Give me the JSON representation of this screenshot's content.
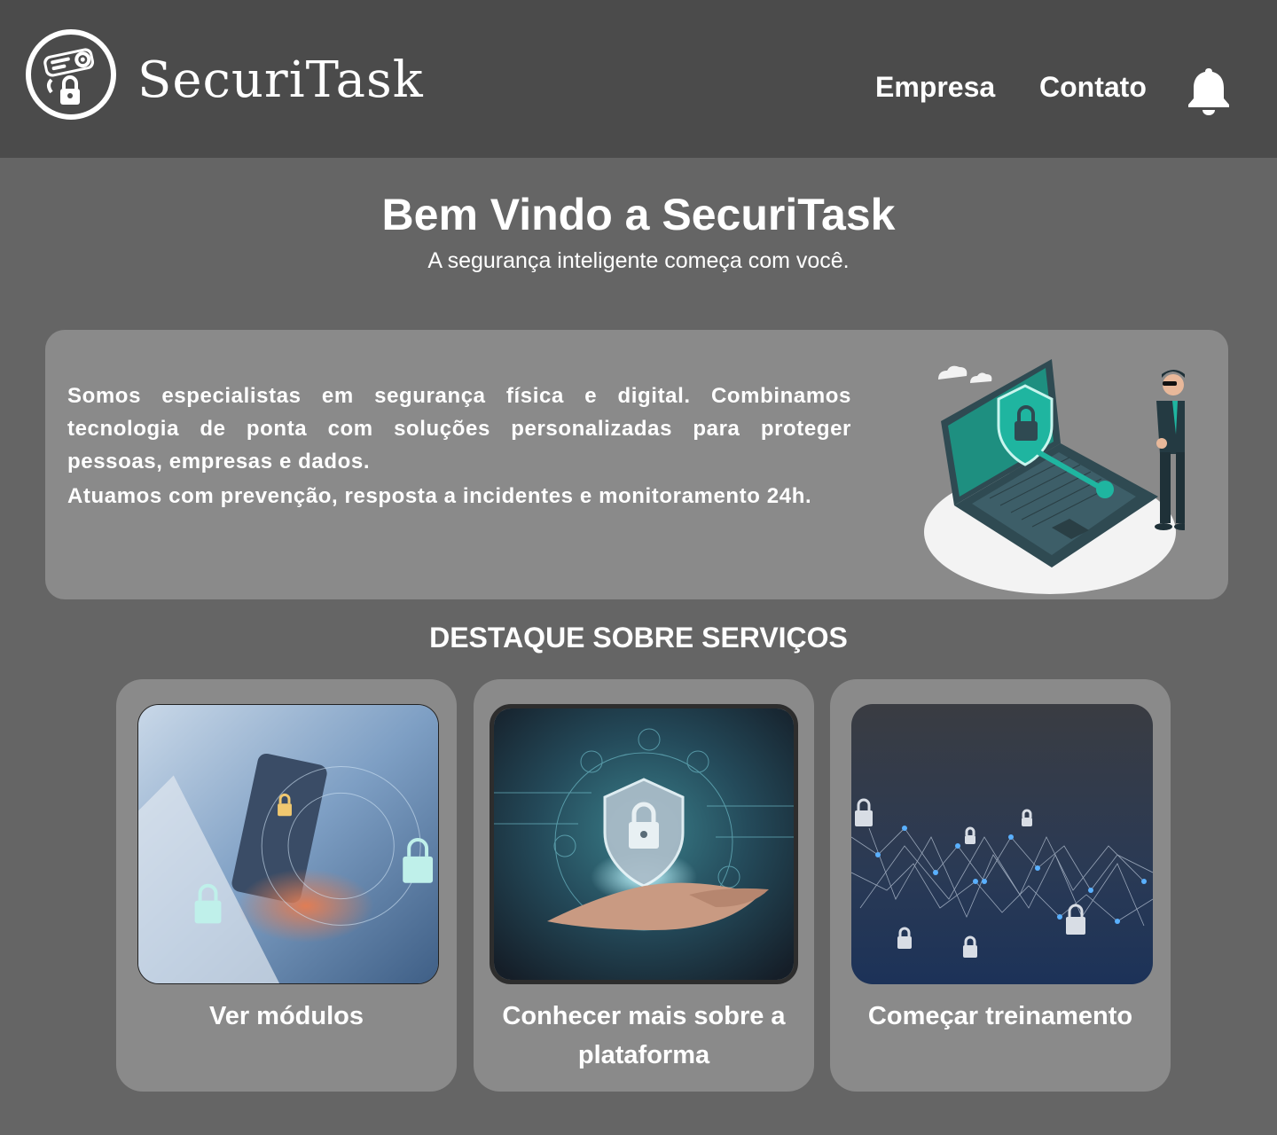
{
  "header": {
    "brand": "SecuriTask",
    "nav": [
      {
        "label": "Empresa"
      },
      {
        "label": "Contato"
      }
    ],
    "icons": {
      "logo": "camera-lock-icon",
      "notifications": "bell-icon"
    }
  },
  "hero": {
    "title": "Bem Vindo a SecuriTask",
    "subtitle": "A segurança inteligente começa com você."
  },
  "about": {
    "paragraphs": [
      "Somos especialistas em segurança física e digital. Combinamos tecnologia de ponta com soluções personalizadas para proteger pessoas, empresas e dados.",
      "Atuamos com prevenção, resposta a incidentes e monitoramento 24h."
    ]
  },
  "services": {
    "title": "DESTAQUE SOBRE SERVIÇOS",
    "cards": [
      {
        "label": "Ver módulos"
      },
      {
        "label": "Conhecer mais sobre a plataforma"
      },
      {
        "label": "Começar treinamento"
      }
    ]
  },
  "colors": {
    "header_bg": "#4b4b4b",
    "page_bg": "#656565",
    "card_bg": "#8a8a8a",
    "accent_teal": "#1fb5a0"
  }
}
